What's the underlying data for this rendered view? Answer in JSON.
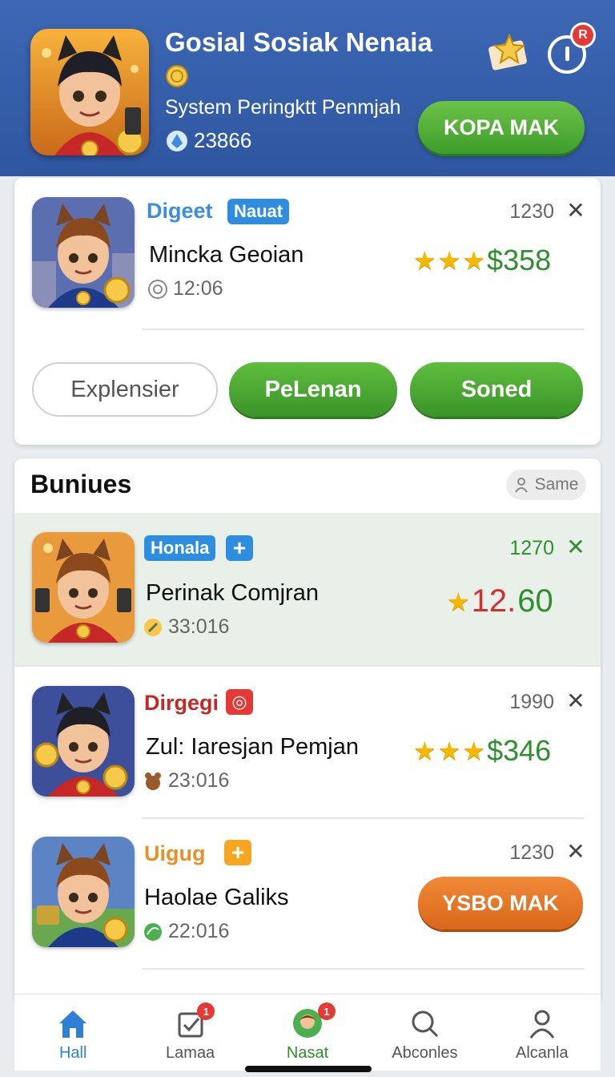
{
  "header": {
    "title": "Gosial Sosiak Nenaia",
    "subtitle": "System Peringktt Penmjah",
    "stat_value": "23866",
    "action_label": "KOPA MAK",
    "notification_badge": "R",
    "colors": {
      "bg": "#3a63ad",
      "action": "#4caf37",
      "badge": "#e53935"
    }
  },
  "featured": {
    "name": "Digeet",
    "tag": "Nauat",
    "count": "1230",
    "close": "✕",
    "title": "Mincka Geoian",
    "time": "12:06",
    "stars": 3,
    "price": "$358",
    "buttons": {
      "outline": "Explensier",
      "primary": "PeLenan",
      "secondary": "Soned"
    }
  },
  "section": {
    "title": "Buniues",
    "action_label": "Same",
    "items": [
      {
        "name": "Honala",
        "tag": "+",
        "count": "1270",
        "close": "✕",
        "title": "Perinak Comjran",
        "time": "33:016",
        "stars": 1,
        "price_red": "12.",
        "price_green": "60"
      },
      {
        "name": "Dirgegi",
        "tag": "◎",
        "count": "1990",
        "close": "✕",
        "title": "Zul: Iaresjan Pemjan",
        "time": "23:016",
        "stars": 3,
        "price": "$346"
      },
      {
        "name": "Uigug",
        "tag": "+",
        "count": "1230",
        "close": "✕",
        "title": "Haolae Galiks",
        "time": "22:016",
        "action_label": "YSBO MAK"
      }
    ]
  },
  "nav": {
    "items": [
      {
        "label": "Hall",
        "icon": "home-icon",
        "active": true
      },
      {
        "label": "Lamaa",
        "icon": "checklist-icon",
        "badge": "1"
      },
      {
        "label": "Nasat",
        "icon": "avatar-icon",
        "badge": "1"
      },
      {
        "label": "Abconles",
        "icon": "search-icon"
      },
      {
        "label": "Alcanla",
        "icon": "profile-icon"
      }
    ]
  }
}
